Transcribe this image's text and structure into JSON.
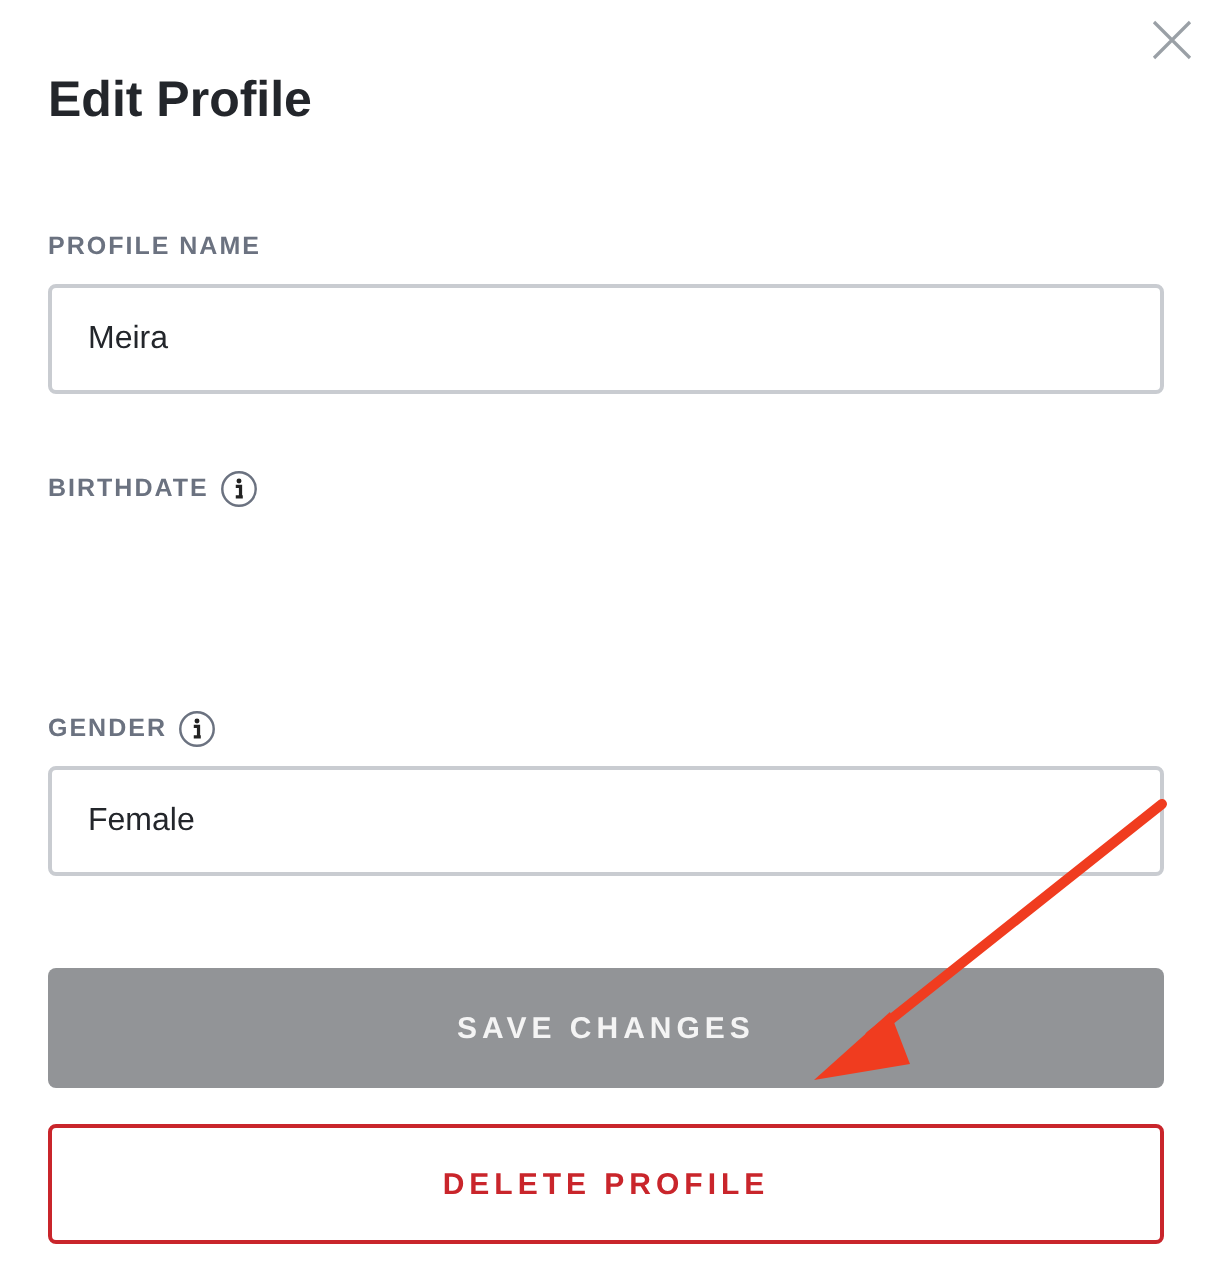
{
  "dialog": {
    "title": "Edit Profile"
  },
  "fields": [
    {
      "kind": "text",
      "label": "PROFILE NAME",
      "info": false,
      "value": "Meira"
    },
    {
      "kind": "empty",
      "label": "BIRTHDATE",
      "info": true
    },
    {
      "kind": "select",
      "label": "GENDER",
      "info": true,
      "value": "Female"
    }
  ],
  "buttons": [
    {
      "kind": "primary",
      "label": "SAVE CHANGES",
      "disabled": true
    },
    {
      "kind": "danger",
      "label": "DELETE PROFILE",
      "disabled": false
    }
  ]
}
